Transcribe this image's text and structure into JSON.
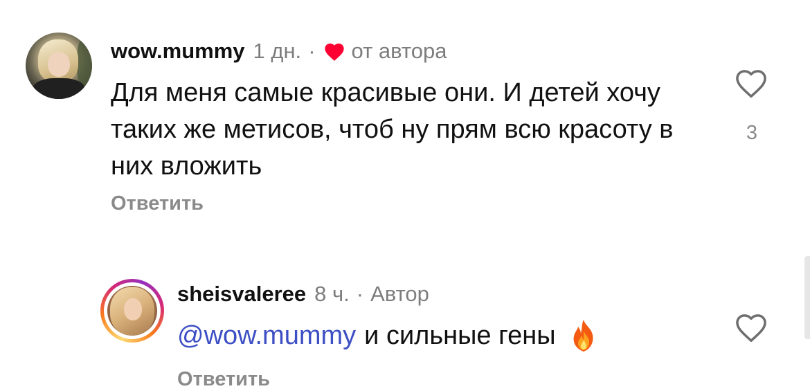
{
  "comments": [
    {
      "username": "wow.mummy",
      "time": "1 дн.",
      "separator": "·",
      "liked_by_author_label": "от автора",
      "text": "Для меня самые красивые они. И детей хочу таких же метисов, чтоб ну прям всю красоту в них вложить",
      "reply_label": "Ответить",
      "like_count": "3",
      "liked_by_author_heart_color": "#ff0033",
      "avatar_icon": "avatar-photo"
    },
    {
      "username": "sheisvaleree",
      "time": "8 ч.",
      "separator": "·",
      "author_badge": "Автор",
      "mention": "@wow.mummy",
      "text": "и сильные гены",
      "emoji": "fire-emoji",
      "reply_label": "Ответить",
      "avatar_icon": "avatar-photo-story-ring"
    }
  ],
  "colors": {
    "mention": "#3d4fc4",
    "secondary_text": "#7d7d7d",
    "heart_author": "#ff0033"
  }
}
